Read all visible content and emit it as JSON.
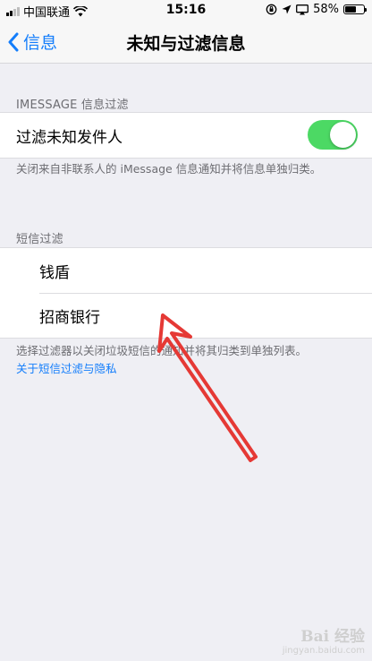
{
  "status_bar": {
    "carrier": "中国联通",
    "time": "15:16",
    "battery_percent": "58%",
    "battery_level": 0.58
  },
  "nav": {
    "back_label": "信息",
    "title": "未知与过滤信息"
  },
  "imessage_section": {
    "header": "IMESSAGE 信息过滤",
    "filter_row_label": "过滤未知发件人",
    "toggle_on": true,
    "footer": "关闭来自非联系人的 iMessage 信息通知并将信息单独归类。"
  },
  "sms_section": {
    "header": "短信过滤",
    "items": [
      {
        "label": "钱盾"
      },
      {
        "label": "招商银行"
      }
    ],
    "footer": "选择过滤器以关闭垃圾短信的通知并将其归类到单独列表。",
    "link": "关于短信过滤与隐私"
  },
  "watermark": {
    "brand": "Bai 经验",
    "url": "jingyan.baidu.com"
  },
  "colors": {
    "accent": "#147efb",
    "toggle_on": "#4cd964",
    "annotation_arrow": "#e53935"
  }
}
